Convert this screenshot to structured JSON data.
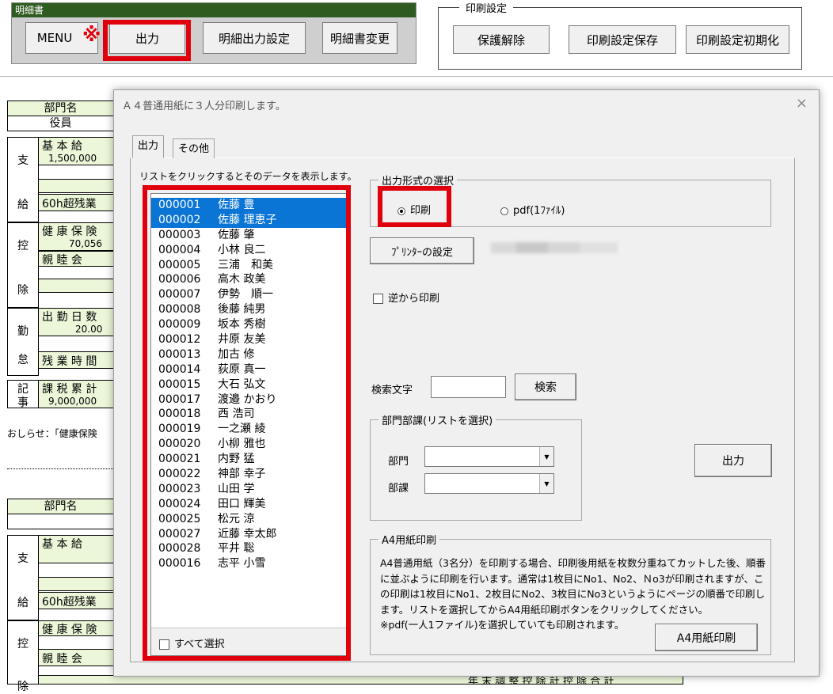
{
  "toolbar": {
    "panel_title": "明細書",
    "menu": "MENU",
    "menu_mark": "※",
    "output": "出力",
    "detail_output_settings": "明細出力設定",
    "change_statement": "明細書変更"
  },
  "print_settings": {
    "legend": "印刷設定",
    "unprotect": "保護解除",
    "save": "印刷設定保存",
    "reset": "印刷設定初期化"
  },
  "sheet": {
    "dept_header": "部門名",
    "role": "役員",
    "pay_side": "支",
    "pay_side2": "給",
    "base_pay": "基 本 給",
    "base_pay_value": "1,500,000",
    "overtime60": "60h超残業",
    "deduct_side": "控",
    "deduct_side2": "除",
    "health_ins": "健 康 保 険",
    "health_value": "70,056",
    "social_club": "親 睦 会",
    "attendance_side": "勤",
    "attendance_side2": "怠",
    "work_days": "出 勤 日 数",
    "work_days_value": "20.00",
    "overtime_hours": "残 業 時 間",
    "record_side": "記",
    "record_side2": "事",
    "tax_total": "課 税 累 計",
    "tax_total_value": "9,000,000",
    "notice": "おしらせ：「健康保険",
    "bottom_label": "年 末 調 整 控 除 計 控 除 合 計"
  },
  "dialog": {
    "title": "Ａ４普通用紙に３人分印刷します。",
    "close_glyph": "×",
    "tabs": [
      "出力",
      "その他"
    ],
    "hint": "リストをクリックするとそのデータを表示します。",
    "employees": [
      {
        "no": "000001",
        "name": "佐藤 豊",
        "selected": true
      },
      {
        "no": "000002",
        "name": "佐藤 理恵子",
        "selected": true
      },
      {
        "no": "000003",
        "name": "佐藤 肇",
        "selected": false
      },
      {
        "no": "000004",
        "name": "小林 良二",
        "selected": false
      },
      {
        "no": "000005",
        "name": "三浦　和美",
        "selected": false
      },
      {
        "no": "000006",
        "name": "高木 政美",
        "selected": false
      },
      {
        "no": "000007",
        "name": "伊勢　順一",
        "selected": false
      },
      {
        "no": "000008",
        "name": "後藤 純男",
        "selected": false
      },
      {
        "no": "000009",
        "name": "坂本 秀樹",
        "selected": false
      },
      {
        "no": "000012",
        "name": "井原 友美",
        "selected": false
      },
      {
        "no": "000013",
        "name": "加古 修",
        "selected": false
      },
      {
        "no": "000014",
        "name": "荻原 真一",
        "selected": false
      },
      {
        "no": "000015",
        "name": "大石 弘文",
        "selected": false
      },
      {
        "no": "000017",
        "name": "渡邉 かおり",
        "selected": false
      },
      {
        "no": "000018",
        "name": "西 浩司",
        "selected": false
      },
      {
        "no": "000019",
        "name": "一之瀬 綾",
        "selected": false
      },
      {
        "no": "000020",
        "name": "小柳 雅也",
        "selected": false
      },
      {
        "no": "000021",
        "name": "内野 猛",
        "selected": false
      },
      {
        "no": "000022",
        "name": "神部 幸子",
        "selected": false
      },
      {
        "no": "000023",
        "name": "山田 学",
        "selected": false
      },
      {
        "no": "000024",
        "name": "田口 輝美",
        "selected": false
      },
      {
        "no": "000025",
        "name": "松元 涼",
        "selected": false
      },
      {
        "no": "000027",
        "name": "近藤 幸太郎",
        "selected": false
      },
      {
        "no": "000028",
        "name": "平井 聡",
        "selected": false
      },
      {
        "no": "000016",
        "name": "志平 小雪",
        "selected": false
      }
    ],
    "select_all": "すべて選択",
    "format_legend": "出力形式の選択",
    "radio_print": "印刷",
    "radio_pdf": "pdf(1ﾌｧｲﾙ)",
    "printer_settings": "ﾌﾟﾘﾝﾀｰの設定",
    "reverse_print": "逆から印刷",
    "search_label": "検索文字",
    "search_value": "",
    "search_button": "検索",
    "dept_legend": "部門部課(リストを選択)",
    "dept_label": "部門",
    "section_label": "部課",
    "dept_value": "",
    "section_value": "",
    "output_button": "出力",
    "a4_legend": "A4用紙印刷",
    "a4_description": "A4普通用紙（3名分）を印刷する場合、印刷後用紙を枚数分重ねてカットした後、順番に並ぶように印刷を行います。通常は1枚目にNo1、No2、Ｎo3が印刷されますが、この印刷は1枚目にNo1、2枚目にNo2、3枚目にNo3というようにページの順番で印刷します。リストを選択してからA4用紙印刷ボタンをクリックしてください。",
    "a4_note": "※pdf(一人1ファイル)を選択していても印刷されます。",
    "a4_button": "A4用紙印刷"
  },
  "colors": {
    "highlight_red": "#e0000b",
    "selection_blue": "#0a75d4",
    "sheet_green": "#ecf7d9",
    "panel_title_green": "#2f5b20"
  }
}
